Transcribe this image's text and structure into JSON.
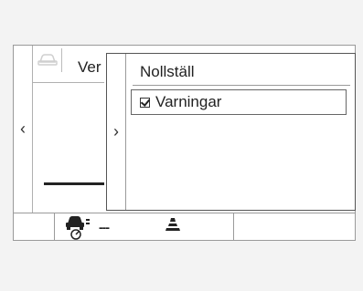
{
  "back_panel": {
    "title": "Ver",
    "left_arrow": "‹",
    "icon": "car-icon"
  },
  "overlay_menu": {
    "arrow": "›",
    "items": [
      {
        "label": "Nollställ"
      },
      {
        "label": "Varningar",
        "checked": true
      }
    ]
  },
  "status_bar": {
    "acc_icon": "adaptive-cruise-icon",
    "acc_value": "---",
    "lane_icon": "lane-assist-icon"
  }
}
